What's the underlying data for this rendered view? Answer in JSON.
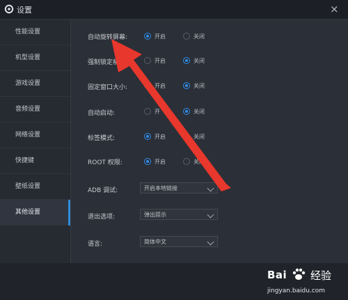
{
  "window": {
    "title": "设置",
    "close_glyph": "×"
  },
  "sidebar": {
    "items": [
      {
        "label": "性能设置"
      },
      {
        "label": "机型设置"
      },
      {
        "label": "游戏设置"
      },
      {
        "label": "音频设置"
      },
      {
        "label": "网络设置"
      },
      {
        "label": "快捷键"
      },
      {
        "label": "壁纸设置"
      },
      {
        "label": "其他设置",
        "active": true
      }
    ]
  },
  "settings": {
    "auto_rotate": {
      "label": "自动旋转屏幕:",
      "on": "开启",
      "off": "关闭",
      "value": "on"
    },
    "force_lock": {
      "label": "强制锁定横",
      "on": "开启",
      "off": "关闭",
      "value": "off"
    },
    "fixed_size": {
      "label": "固定窗口大小:",
      "on": "开启",
      "off": "关闭",
      "value": "off"
    },
    "autostart": {
      "label": "自动启动:",
      "on": "开",
      "off": "关闭",
      "value": "off"
    },
    "tab_mode": {
      "label": "标签模式:",
      "on": "开启",
      "off": "关闭",
      "value": "on"
    },
    "root": {
      "label": "ROOT 权限:",
      "on": "开启",
      "off": "关闭",
      "value": "on"
    },
    "adb": {
      "label": "ADB 调试:",
      "value": "开启本地链接"
    },
    "exit": {
      "label": "退出选项:",
      "value": "弹出提示"
    },
    "lang": {
      "label": "语言:",
      "value": "简体中文"
    }
  },
  "watermark": {
    "brand_text_a": "Bai",
    "brand_text_b": "百",
    "jingyan": "经验",
    "url": "jingyan.baidu.com"
  },
  "colors": {
    "accent": "#2f8ff0",
    "arrow": "#e8372c",
    "bg": "#2b2f37"
  }
}
